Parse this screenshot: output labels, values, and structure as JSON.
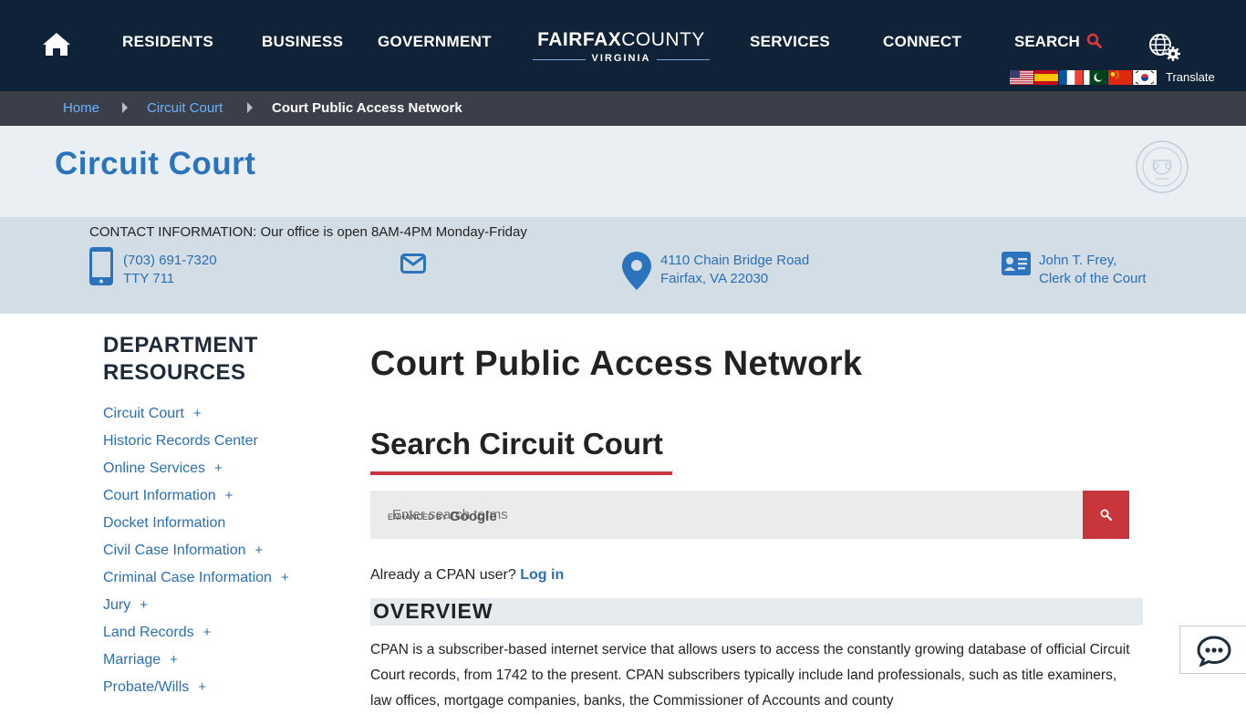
{
  "nav": {
    "items": [
      "RESIDENTS",
      "BUSINESS",
      "GOVERNMENT",
      "SERVICES",
      "CONNECT"
    ],
    "search_label": "SEARCH",
    "translate_label": "Translate",
    "logo": {
      "main_bold": "FAIRFAX",
      "main_light": "COUNTY",
      "sub": "VIRGINIA"
    }
  },
  "breadcrumb": {
    "items": [
      "Home",
      "Circuit Court",
      "Court Public Access Network"
    ]
  },
  "dept_title": "Circuit Court",
  "contact": {
    "heading": "CONTACT INFORMATION: Our office is open 8AM-4PM Monday-Friday",
    "phone": "(703) 691-7320",
    "tty": "TTY 711",
    "address_line1": "4110 Chain Bridge Road",
    "address_line2": "Fairfax, VA 22030",
    "clerk_name": "John T. Frey,",
    "clerk_title": "Clerk of the Court"
  },
  "sidebar": {
    "title_line1": "DEPARTMENT",
    "title_line2": "RESOURCES",
    "items": [
      {
        "label": "Circuit Court",
        "plus": "+"
      },
      {
        "label": "Historic Records Center",
        "plus": ""
      },
      {
        "label": "Online Services",
        "plus": "+"
      },
      {
        "label": "Court Information",
        "plus": "+"
      },
      {
        "label": "Docket Information",
        "plus": ""
      },
      {
        "label": "Civil Case Information",
        "plus": "+"
      },
      {
        "label": "Criminal Case Information",
        "plus": "+"
      },
      {
        "label": "Jury",
        "plus": "+"
      },
      {
        "label": "Land Records",
        "plus": "+"
      },
      {
        "label": "Marriage",
        "plus": "+"
      },
      {
        "label": "Probate/Wills",
        "plus": "+"
      }
    ]
  },
  "main": {
    "page_title": "Court Public Access Network",
    "section_title": "Search Circuit Court",
    "search_placeholder": "Enter search terms",
    "enhanced_by": "ENHANCED BY",
    "google": "Google",
    "already_text": "Already a CPAN user?",
    "login_link": "Log in",
    "overview_title": "OVERVIEW",
    "overview_text": "CPAN is a subscriber-based internet service that allows users to access the constantly growing database of official Circuit Court records, from 1742 to the present.  CPAN subscribers typically include land professionals, such as title examiners, law offices, mortgage companies, banks, the Commissioner of Accounts and county"
  },
  "colors": {
    "nav_bg": "#0f2237",
    "breadcrumb_bg": "#3b3f4a",
    "accent_blue": "#2b74bd",
    "accent_red": "#c8353a",
    "contact_bg": "#d2dde6",
    "title_band_bg": "#e9eff3"
  },
  "icons": [
    "home-icon",
    "search-icon",
    "globe-gear-icon",
    "phone-icon",
    "envelope-icon",
    "map-pin-icon",
    "id-card-icon",
    "chat-icon"
  ]
}
